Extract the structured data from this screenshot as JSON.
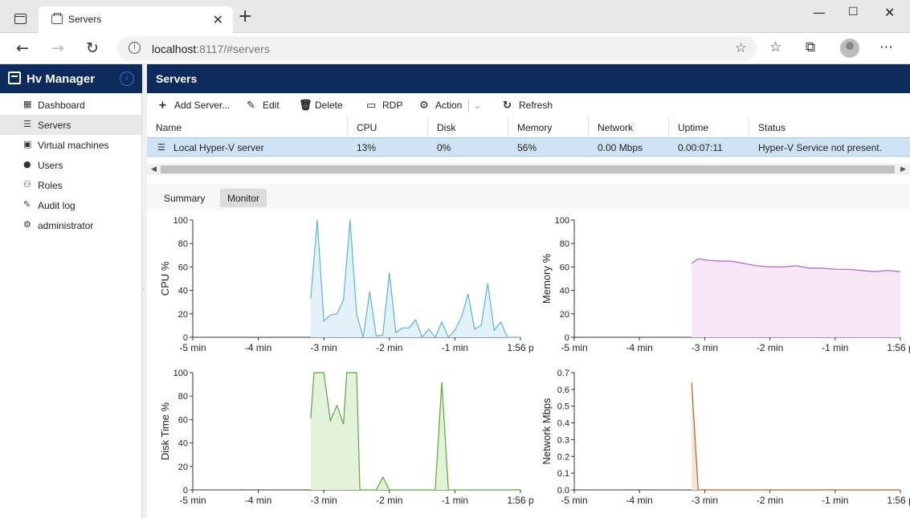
{
  "browser": {
    "tab_title": "Servers",
    "url_host": "localhost",
    "url_rest": ":8117/#servers"
  },
  "app": {
    "brand": "Hv Manager",
    "page_title": "Servers"
  },
  "sidebar": {
    "items": [
      {
        "label": "Dashboard",
        "icon": "dashboard-icon",
        "active": false
      },
      {
        "label": "Servers",
        "icon": "server-icon",
        "active": true
      },
      {
        "label": "Virtual machines",
        "icon": "vm-icon",
        "active": false
      },
      {
        "label": "Users",
        "icon": "user-icon",
        "active": false
      },
      {
        "label": "Roles",
        "icon": "roles-icon",
        "active": false
      },
      {
        "label": "Audit log",
        "icon": "audit-icon",
        "active": false
      },
      {
        "label": "administrator",
        "icon": "admin-icon",
        "active": false
      }
    ]
  },
  "toolbar": {
    "add": "Add Server...",
    "edit": "Edit",
    "delete": "Delete",
    "rdp": "RDP",
    "action": "Action",
    "refresh": "Refresh"
  },
  "table": {
    "columns": [
      "Name",
      "CPU",
      "Disk",
      "Memory",
      "Network",
      "Uptime",
      "Status"
    ],
    "rows": [
      [
        "Local Hyper-V server",
        "13%",
        "0%",
        "56%",
        "0.00 Mbps",
        "0.00:07:11",
        "Hyper-V Service not present."
      ]
    ]
  },
  "subtabs": [
    "Summary",
    "Monitor"
  ],
  "chart_data": [
    {
      "type": "area",
      "ylabel": "CPU %",
      "ylim": [
        0,
        100
      ],
      "yticks": [
        0,
        20,
        40,
        60,
        80,
        100
      ],
      "xticks": [
        "-5 min",
        "-4 min",
        "-3 min",
        "-2 min",
        "-1 min",
        "1:56 p"
      ],
      "color": "#5ab4d6",
      "fill": "#e3f1f9",
      "x": [
        -3.2,
        -3.1,
        -3.0,
        -2.9,
        -2.8,
        -2.7,
        -2.6,
        -2.5,
        -2.4,
        -2.3,
        -2.2,
        -2.1,
        -2.0,
        -1.9,
        -1.8,
        -1.7,
        -1.6,
        -1.5,
        -1.4,
        -1.3,
        -1.2,
        -1.1,
        -1.0,
        -0.9,
        -0.8,
        -0.7,
        -0.6,
        -0.5,
        -0.4,
        -0.3,
        -0.2,
        -0.1,
        0.0
      ],
      "y": [
        33,
        100,
        14,
        19,
        20,
        32,
        100,
        20,
        0,
        39,
        1,
        2,
        55,
        4,
        8,
        8,
        15,
        0,
        7,
        0,
        13,
        0,
        6,
        17,
        37,
        7,
        10,
        46,
        6,
        13,
        0,
        0,
        0
      ]
    },
    {
      "type": "area",
      "ylabel": "Memory %",
      "ylim": [
        0,
        100
      ],
      "yticks": [
        0,
        20,
        40,
        60,
        80,
        100
      ],
      "xticks": [
        "-5 min",
        "-4 min",
        "-3 min",
        "-2 min",
        "-1 min",
        "1:56 p"
      ],
      "color": "#b565c8",
      "fill": "#f6e8f7",
      "x": [
        -3.2,
        -3.1,
        -3.0,
        -2.8,
        -2.6,
        -2.4,
        -2.2,
        -2.0,
        -1.8,
        -1.6,
        -1.4,
        -1.2,
        -1.0,
        -0.8,
        -0.6,
        -0.4,
        -0.2,
        0.0
      ],
      "y": [
        63,
        67,
        66,
        65,
        65,
        63,
        61,
        60,
        60,
        61,
        59,
        59,
        58,
        58,
        57,
        56,
        57,
        56
      ]
    },
    {
      "type": "area",
      "ylabel": "Disk Time %",
      "ylim": [
        0,
        100
      ],
      "yticks": [
        0,
        20,
        40,
        60,
        80,
        100
      ],
      "xticks": [
        "-5 min",
        "-4 min",
        "-3 min",
        "-2 min",
        "-1 min",
        "1:56 p"
      ],
      "color": "#5caa36",
      "fill": "#e3f2da",
      "x": [
        -3.2,
        -3.15,
        -3.0,
        -2.9,
        -2.8,
        -2.7,
        -2.65,
        -2.5,
        -2.45,
        -2.4,
        -2.2,
        -2.1,
        -2.0,
        -1.9,
        -1.4,
        -1.3,
        -1.2,
        -1.1,
        -1.0,
        0.0
      ],
      "y": [
        61,
        100,
        100,
        59,
        72,
        56,
        100,
        100,
        0,
        0,
        0,
        11,
        0,
        0,
        0,
        0,
        92,
        0,
        0,
        0
      ]
    },
    {
      "type": "area",
      "ylabel": "Network Mbps",
      "ylim": [
        0,
        0.7
      ],
      "yticks": [
        0.0,
        0.1,
        0.2,
        0.3,
        0.4,
        0.5,
        0.6,
        0.7
      ],
      "xticks": [
        "-5 min",
        "-4 min",
        "-3 min",
        "-2 min",
        "-1 min",
        "1:56 p"
      ],
      "color": "#c25e1c",
      "fill": "#f4e3da",
      "x": [
        -3.2,
        -3.1,
        -3.0,
        -2.0,
        -1.0,
        0.0
      ],
      "y": [
        0.64,
        0.0,
        0.0,
        0.0,
        0.0,
        0.0
      ]
    }
  ]
}
